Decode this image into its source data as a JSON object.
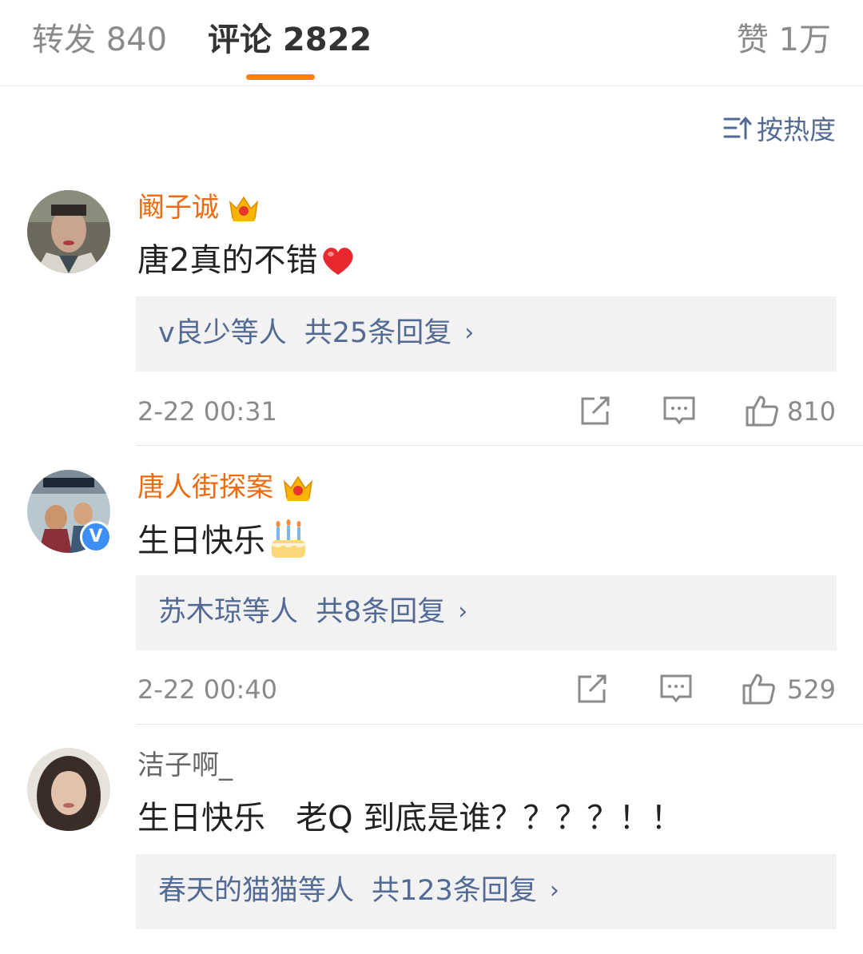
{
  "tabs": {
    "repost_label": "转发 840",
    "comment_label": "评论 2822",
    "like_label": "赞 1万"
  },
  "sort": {
    "label": "按热度",
    "icon": "sort-hot-icon"
  },
  "colors": {
    "accent": "#ff8200",
    "link": "#536a94",
    "vip_name": "#f06a0f"
  },
  "comments": [
    {
      "username": "阚子诚",
      "badge": "crown-badge-icon",
      "text": "唐2真的不错",
      "emoji": "heart-emoji",
      "reply_users": "v良少等人",
      "reply_count": "共25条回复",
      "time": "2-22 00:31",
      "likes": "810"
    },
    {
      "username": "唐人街探案",
      "badge": "crown-badge-icon",
      "verified": "verified-badge-icon",
      "text": "生日快乐",
      "emoji": "birthday-cake-emoji",
      "reply_users": "苏木琼等人",
      "reply_count": "共8条回复",
      "time": "2-22 00:40",
      "likes": "529"
    },
    {
      "username": "洁子啊_",
      "text": "生日快乐   老Q 到底是谁？？？？！！",
      "reply_users": "春天的猫猫等人",
      "reply_count": "共123条回复"
    }
  ]
}
